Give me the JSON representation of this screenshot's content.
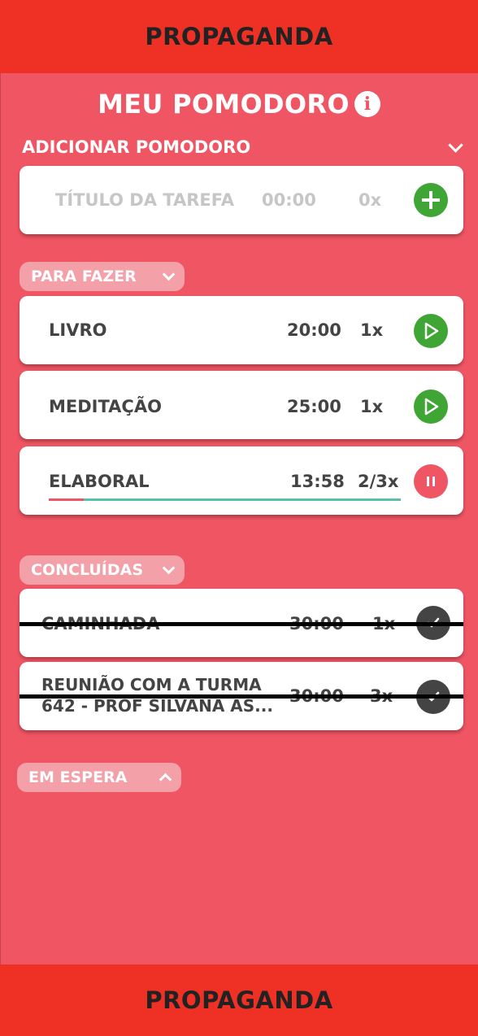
{
  "ads": {
    "top": "PROPAGANDA",
    "bottom": "PROPAGANDA"
  },
  "header": {
    "title": "MEU POMODORO",
    "info_icon": "info-icon"
  },
  "add_section": {
    "label": "ADICIONAR POMODORO",
    "title_placeholder": "TÍTULO DA TAREFA",
    "time_placeholder": "00:00",
    "count_placeholder": "0x",
    "add_icon": "plus-icon"
  },
  "todo": {
    "label": "PARA FAZER",
    "items": [
      {
        "name": "LIVRO",
        "time": "20:00",
        "count": "1x",
        "action": "play-icon"
      },
      {
        "name": "MEDITAÇÃO",
        "time": "25:00",
        "count": "1x",
        "action": "play-icon"
      },
      {
        "name": "ELABORAL",
        "time": "13:58",
        "count": "2/3x",
        "action": "pause-icon",
        "progress": 0.1
      }
    ]
  },
  "done": {
    "label": "CONCLUÍDAS",
    "items": [
      {
        "name": "CAMINHADA",
        "time": "30:00",
        "count": "1x",
        "action": "check-icon"
      },
      {
        "name_line1": "REUNIÃO COM A TURMA",
        "name_line2": "642 - PROF SILVANA AS...",
        "time": "30:00",
        "count": "3x",
        "action": "check-icon"
      }
    ]
  },
  "waiting": {
    "label": "EM ESPERA"
  },
  "colors": {
    "background": "#ef5563",
    "ad_bar": "#ee3124",
    "play_green": "#3fa535",
    "pause_red": "#ef5563",
    "done_dark": "#444444",
    "progress_done": "#ef5563",
    "progress_remaining": "#5cc0a8",
    "pill": "#f3a0a8"
  }
}
